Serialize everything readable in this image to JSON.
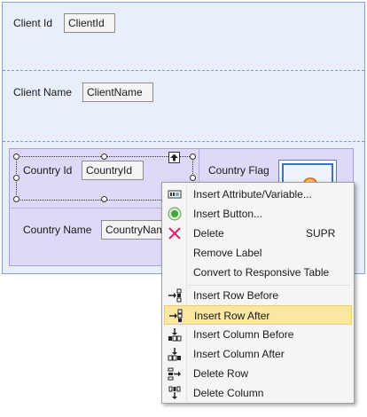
{
  "form": {
    "client_id_label": "Client Id",
    "client_id_value": "ClientId",
    "client_name_label": "Client Name",
    "client_name_value": "ClientName",
    "country_id_label": "Country Id",
    "country_id_value": "CountryId",
    "country_flag_label": "Country Flag",
    "country_name_label": "Country Name",
    "country_name_value": "CountryName"
  },
  "context_menu": {
    "items": [
      {
        "label": "Insert Attribute/Variable...",
        "icon": "attribute-variable-icon"
      },
      {
        "label": "Insert Button...",
        "icon": "button-icon"
      },
      {
        "label": "Delete",
        "shortcut": "SUPR",
        "icon": "delete-x-icon"
      },
      {
        "label": "Remove Label"
      },
      {
        "label": "Convert to Responsive Table"
      },
      {
        "label": "Insert Row Before",
        "icon": "insert-row-before-icon"
      },
      {
        "label": "Insert Row After",
        "icon": "insert-row-after-icon",
        "highlighted": true
      },
      {
        "label": "Insert Column Before",
        "icon": "insert-column-before-icon"
      },
      {
        "label": "Insert Column After",
        "icon": "insert-column-after-icon"
      },
      {
        "label": "Delete Row",
        "icon": "delete-row-icon"
      },
      {
        "label": "Delete Column",
        "icon": "delete-column-icon"
      }
    ]
  },
  "colors": {
    "designer_bg": "#e8eefa",
    "inner_table_bg": "#ddd9f6",
    "menu_highlight": "#fbe7a4",
    "delete_icon": "#e0206a"
  }
}
